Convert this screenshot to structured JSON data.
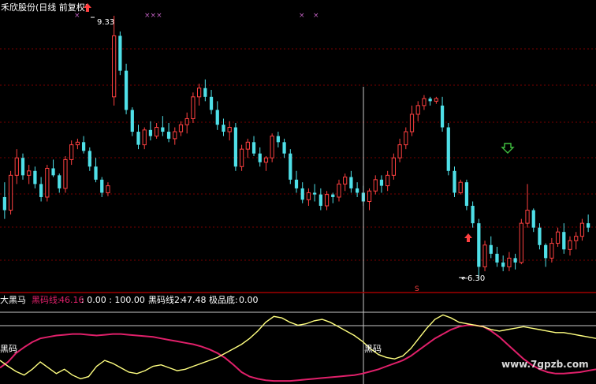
{
  "header": {
    "title": "禾欣股份(日线 前复权)"
  },
  "main_panel": {
    "high_label": "9.33",
    "low_label": "6.30",
    "markers_text": [
      "×",
      "×××",
      "×",
      "×"
    ],
    "s_marker": "S"
  },
  "indicator_panel": {
    "name": "大黑马",
    "items": [
      {
        "label": "黑码线:",
        "value": "46.16"
      },
      {
        "label": "",
        "value": ": 0.00 : 100.00"
      },
      {
        "label": "黑码线2:",
        "value": "47.48"
      },
      {
        "label": "极品底:",
        "value": "0.00"
      }
    ],
    "heima_label_1": "黑码",
    "heima_label_2": "黑码"
  },
  "watermark": "www.7gpzb.com",
  "colors": {
    "up": "#ff4040",
    "down": "#4fe0e8",
    "axis": "#a00000",
    "grid": "#a00000",
    "cursor": "#c8c8c8",
    "line_pink": "#e0206a",
    "line_yellow": "#ffff80",
    "marker_purple": "#c060c0",
    "arrow_green": "#40c040"
  },
  "chart_data": {
    "type": "candlestick",
    "title": "禾欣股份(日线 前复权)",
    "price_high": 9.33,
    "price_low": 6.3,
    "candles": [
      [
        7.25,
        7.42,
        7.0,
        7.1
      ],
      [
        7.1,
        7.55,
        7.05,
        7.5
      ],
      [
        7.5,
        7.8,
        7.4,
        7.7
      ],
      [
        7.7,
        7.75,
        7.45,
        7.5
      ],
      [
        7.5,
        7.62,
        7.4,
        7.55
      ],
      [
        7.55,
        7.6,
        7.35,
        7.4
      ],
      [
        7.4,
        7.48,
        7.2,
        7.25
      ],
      [
        7.25,
        7.62,
        7.2,
        7.58
      ],
      [
        7.58,
        7.68,
        7.48,
        7.5
      ],
      [
        7.5,
        7.52,
        7.3,
        7.35
      ],
      [
        7.35,
        7.72,
        7.3,
        7.68
      ],
      [
        7.68,
        7.9,
        7.62,
        7.85
      ],
      [
        7.85,
        7.92,
        7.8,
        7.88
      ],
      [
        7.88,
        7.95,
        7.75,
        7.78
      ],
      [
        7.78,
        7.82,
        7.55,
        7.6
      ],
      [
        7.6,
        7.7,
        7.42,
        7.45
      ],
      [
        7.45,
        7.48,
        7.25,
        7.3
      ],
      [
        7.3,
        7.42,
        7.26,
        7.38
      ],
      [
        8.4,
        9.33,
        8.3,
        9.1
      ],
      [
        9.1,
        9.15,
        8.65,
        8.7
      ],
      [
        8.7,
        8.78,
        8.2,
        8.25
      ],
      [
        8.25,
        8.28,
        7.95,
        8.0
      ],
      [
        8.0,
        8.08,
        7.8,
        7.85
      ],
      [
        7.85,
        8.05,
        7.8,
        8.02
      ],
      [
        8.02,
        8.12,
        7.9,
        7.95
      ],
      [
        7.95,
        8.1,
        7.92,
        8.05
      ],
      [
        8.05,
        8.18,
        7.95,
        8.0
      ],
      [
        8.0,
        8.1,
        7.88,
        7.92
      ],
      [
        7.92,
        8.05,
        7.85,
        8.0
      ],
      [
        8.0,
        8.12,
        7.95,
        8.08
      ],
      [
        8.08,
        8.22,
        7.98,
        8.15
      ],
      [
        8.15,
        8.45,
        8.1,
        8.4
      ],
      [
        8.4,
        8.55,
        8.3,
        8.5
      ],
      [
        8.5,
        8.6,
        8.35,
        8.4
      ],
      [
        8.4,
        8.48,
        8.2,
        8.25
      ],
      [
        8.25,
        8.35,
        8.02,
        8.08
      ],
      [
        8.08,
        8.15,
        7.95,
        8.0
      ],
      [
        8.0,
        8.12,
        7.9,
        8.05
      ],
      [
        8.05,
        8.1,
        7.55,
        7.6
      ],
      [
        7.6,
        7.85,
        7.55,
        7.8
      ],
      [
        7.8,
        7.92,
        7.7,
        7.88
      ],
      [
        7.88,
        7.95,
        7.72,
        7.75
      ],
      [
        7.75,
        7.82,
        7.6,
        7.65
      ],
      [
        7.65,
        7.72,
        7.55,
        7.7
      ],
      [
        7.7,
        7.98,
        7.65,
        7.95
      ],
      [
        7.95,
        8.0,
        7.82,
        7.88
      ],
      [
        7.88,
        7.92,
        7.7,
        7.75
      ],
      [
        7.75,
        7.8,
        7.4,
        7.45
      ],
      [
        7.45,
        7.55,
        7.3,
        7.35
      ],
      [
        7.35,
        7.42,
        7.18,
        7.22
      ],
      [
        7.22,
        7.35,
        7.15,
        7.3
      ],
      [
        7.3,
        7.4,
        7.2,
        7.28
      ],
      [
        7.28,
        7.35,
        7.1,
        7.15
      ],
      [
        7.15,
        7.32,
        7.1,
        7.28
      ],
      [
        7.28,
        7.3,
        7.18,
        7.25
      ],
      [
        7.25,
        7.45,
        7.2,
        7.4
      ],
      [
        7.4,
        7.52,
        7.32,
        7.48
      ],
      [
        7.48,
        7.55,
        7.3,
        7.35
      ],
      [
        7.35,
        7.42,
        7.25,
        7.3
      ],
      [
        7.3,
        7.38,
        7.15,
        7.2
      ],
      [
        7.2,
        7.35,
        7.1,
        7.32
      ],
      [
        7.32,
        7.5,
        7.28,
        7.45
      ],
      [
        7.45,
        7.5,
        7.3,
        7.38
      ],
      [
        7.38,
        7.55,
        7.32,
        7.5
      ],
      [
        7.5,
        7.75,
        7.45,
        7.7
      ],
      [
        7.7,
        7.92,
        7.65,
        7.85
      ],
      [
        7.85,
        8.05,
        7.8,
        8.0
      ],
      [
        8.0,
        8.3,
        7.95,
        8.2
      ],
      [
        8.2,
        8.35,
        8.12,
        8.3
      ],
      [
        8.3,
        8.42,
        8.25,
        8.38
      ],
      [
        8.38,
        8.4,
        8.3,
        8.35
      ],
      [
        8.35,
        8.4,
        8.32,
        8.38
      ],
      [
        8.3,
        8.4,
        8.0,
        8.05
      ],
      [
        8.05,
        8.1,
        7.5,
        7.55
      ],
      [
        7.55,
        7.6,
        7.25,
        7.3
      ],
      [
        7.3,
        7.45,
        7.28,
        7.42
      ],
      [
        7.42,
        7.45,
        7.1,
        7.15
      ],
      [
        7.15,
        7.2,
        6.9,
        6.95
      ],
      [
        6.95,
        7.0,
        6.3,
        6.45
      ],
      [
        6.45,
        6.75,
        6.4,
        6.7
      ],
      [
        6.7,
        6.8,
        6.55,
        6.6
      ],
      [
        6.6,
        6.68,
        6.45,
        6.5
      ],
      [
        6.5,
        6.58,
        6.4,
        6.45
      ],
      [
        6.45,
        6.62,
        6.4,
        6.55
      ],
      [
        6.55,
        6.6,
        6.42,
        6.5
      ],
      [
        6.5,
        7.0,
        6.48,
        6.95
      ],
      [
        6.95,
        7.4,
        6.9,
        7.1
      ],
      [
        7.1,
        7.12,
        6.85,
        6.9
      ],
      [
        6.9,
        6.95,
        6.65,
        6.7
      ],
      [
        6.7,
        6.72,
        6.45,
        6.55
      ],
      [
        6.55,
        6.78,
        6.5,
        6.72
      ],
      [
        6.72,
        6.9,
        6.68,
        6.85
      ],
      [
        6.85,
        6.95,
        6.6,
        6.65
      ],
      [
        6.65,
        6.8,
        6.58,
        6.75
      ],
      [
        6.75,
        6.85,
        6.65,
        6.8
      ],
      [
        6.8,
        7.0,
        6.75,
        6.95
      ],
      [
        6.95,
        7.05,
        6.85,
        6.9
      ]
    ],
    "indicator": {
      "series": [
        {
          "name": "黑码线",
          "color": "#e0206a",
          "values": [
            20,
            28,
            40,
            48,
            55,
            60,
            62,
            64,
            65,
            66,
            66,
            65,
            64,
            65,
            66,
            66,
            65,
            64,
            63,
            62,
            60,
            58,
            56,
            54,
            52,
            49,
            45,
            40,
            33,
            24,
            14,
            8,
            5,
            3,
            2,
            2,
            2,
            3,
            4,
            5,
            6,
            7,
            8,
            9,
            10,
            12,
            15,
            18,
            22,
            26,
            30,
            36,
            44,
            52,
            60,
            66,
            72,
            76,
            78,
            78,
            76,
            70,
            62,
            52,
            42,
            32,
            24,
            18,
            14,
            12,
            12,
            13,
            14,
            16,
            18
          ]
        },
        {
          "name": "黑码线2",
          "color": "#ffff80",
          "values": [
            30,
            22,
            15,
            10,
            18,
            28,
            20,
            12,
            18,
            10,
            5,
            8,
            22,
            30,
            26,
            20,
            14,
            12,
            16,
            22,
            24,
            20,
            16,
            18,
            22,
            26,
            30,
            34,
            40,
            46,
            52,
            60,
            70,
            82,
            90,
            88,
            82,
            78,
            80,
            84,
            86,
            82,
            76,
            70,
            64,
            56,
            46,
            38,
            34,
            32,
            36,
            46,
            60,
            74,
            86,
            92,
            88,
            82,
            80,
            78,
            76,
            72,
            70,
            72,
            74,
            76,
            74,
            72,
            70,
            68,
            68,
            66,
            64,
            62,
            60
          ]
        }
      ],
      "values_shown": {
        "黑码线": 46.16,
        "黑码线2": 47.48,
        "极品底": 0.0
      },
      "ylim": [
        0,
        100
      ]
    }
  }
}
